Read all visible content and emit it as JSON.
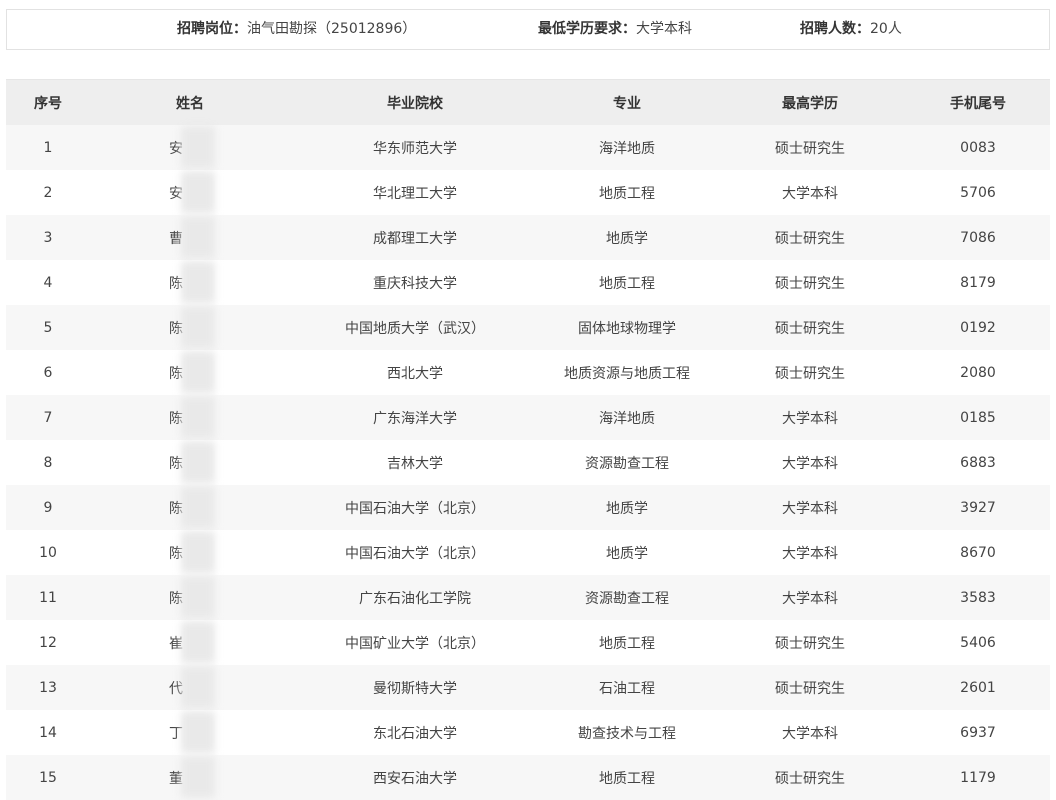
{
  "info": {
    "position_label": "招聘岗位：",
    "position_value": "油气田勘探（25012896）",
    "education_label": "最低学历要求：",
    "education_value": "大学本科",
    "count_label": "招聘人数：",
    "count_value": "20人"
  },
  "table": {
    "headers": [
      "序号",
      "姓名",
      "毕业院校",
      "专业",
      "最高学历",
      "手机尾号"
    ],
    "rows": [
      {
        "no": "1",
        "name": "安",
        "school": "华东师范大学",
        "major": "海洋地质",
        "degree": "硕士研究生",
        "phone": "0083"
      },
      {
        "no": "2",
        "name": "安",
        "school": "华北理工大学",
        "major": "地质工程",
        "degree": "大学本科",
        "phone": "5706"
      },
      {
        "no": "3",
        "name": "曹",
        "school": "成都理工大学",
        "major": "地质学",
        "degree": "硕士研究生",
        "phone": "7086"
      },
      {
        "no": "4",
        "name": "陈",
        "school": "重庆科技大学",
        "major": "地质工程",
        "degree": "硕士研究生",
        "phone": "8179"
      },
      {
        "no": "5",
        "name": "陈",
        "school": "中国地质大学（武汉）",
        "major": "固体地球物理学",
        "degree": "硕士研究生",
        "phone": "0192"
      },
      {
        "no": "6",
        "name": "陈",
        "school": "西北大学",
        "major": "地质资源与地质工程",
        "degree": "硕士研究生",
        "phone": "2080"
      },
      {
        "no": "7",
        "name": "陈",
        "school": "广东海洋大学",
        "major": "海洋地质",
        "degree": "大学本科",
        "phone": "0185"
      },
      {
        "no": "8",
        "name": "陈",
        "school": "吉林大学",
        "major": "资源勘查工程",
        "degree": "大学本科",
        "phone": "6883"
      },
      {
        "no": "9",
        "name": "陈",
        "school": "中国石油大学（北京）",
        "major": "地质学",
        "degree": "大学本科",
        "phone": "3927"
      },
      {
        "no": "10",
        "name": "陈",
        "school": "中国石油大学（北京）",
        "major": "地质学",
        "degree": "大学本科",
        "phone": "8670"
      },
      {
        "no": "11",
        "name": "陈",
        "school": "广东石油化工学院",
        "major": "资源勘查工程",
        "degree": "大学本科",
        "phone": "3583"
      },
      {
        "no": "12",
        "name": "崔",
        "school": "中国矿业大学（北京）",
        "major": "地质工程",
        "degree": "硕士研究生",
        "phone": "5406"
      },
      {
        "no": "13",
        "name": "代",
        "school": "曼彻斯特大学",
        "major": "石油工程",
        "degree": "硕士研究生",
        "phone": "2601"
      },
      {
        "no": "14",
        "name": "丁",
        "school": "东北石油大学",
        "major": "勘查技术与工程",
        "degree": "大学本科",
        "phone": "6937"
      },
      {
        "no": "15",
        "name": "董",
        "school": "西安石油大学",
        "major": "地质工程",
        "degree": "硕士研究生",
        "phone": "1179"
      }
    ]
  }
}
